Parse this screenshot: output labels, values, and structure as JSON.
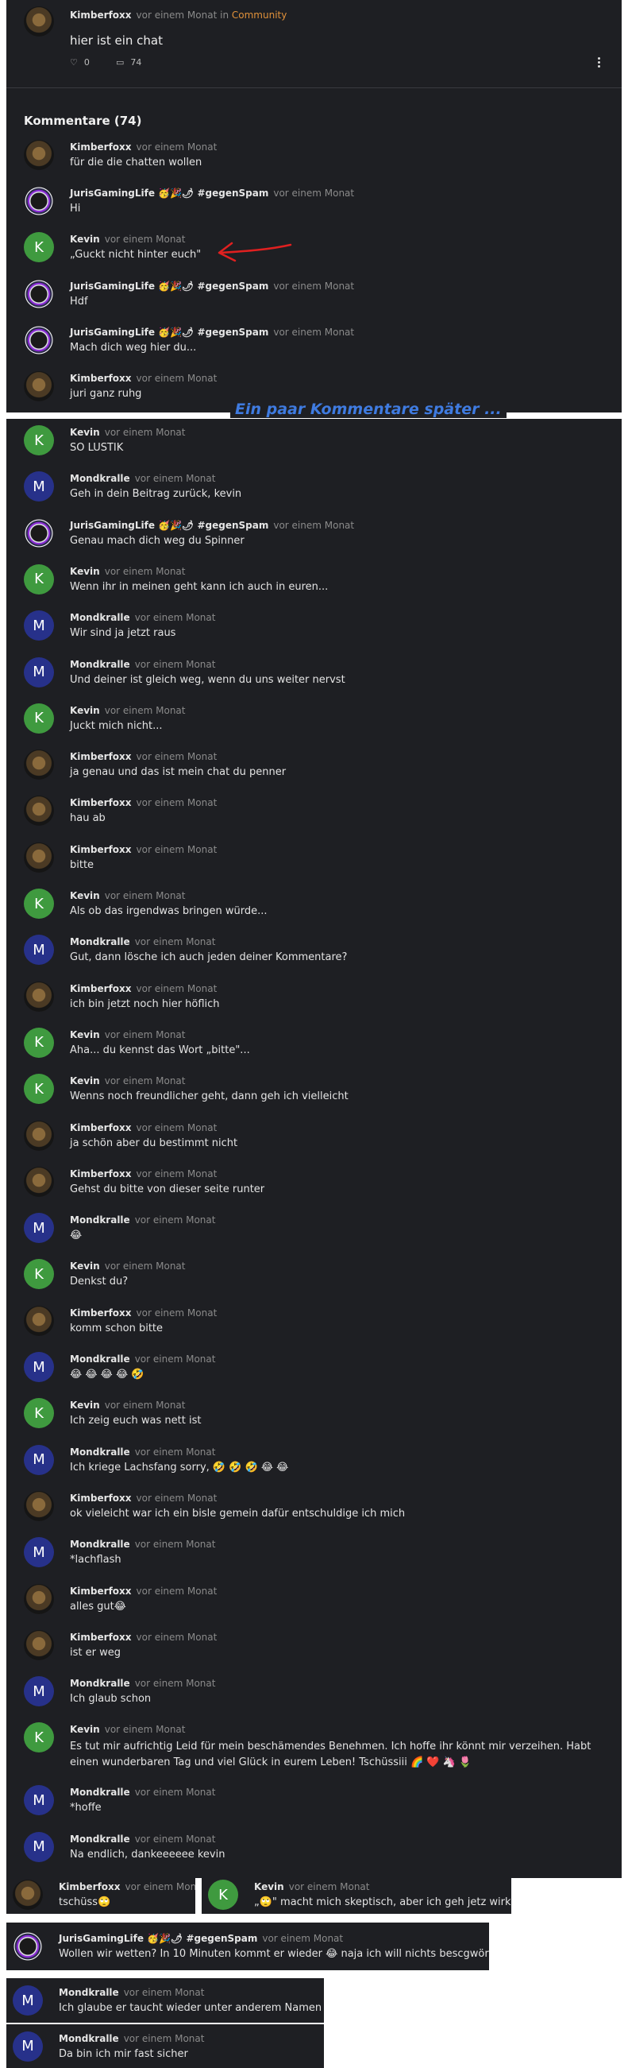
{
  "post": {
    "author": "Kimberfoxx",
    "time": "vor einem Monat",
    "in_label": "in",
    "community": "Community",
    "title": "hier ist ein chat",
    "likes": "0",
    "comments_count": "74"
  },
  "comments_header": "Kommentare (74)",
  "banner_text": "Ein paar Kommentare später ...",
  "top_comments": [
    {
      "av": "lion",
      "initial": "",
      "name": "Kimberfoxx",
      "time": "vor einem Monat",
      "text": "für die die chatten wollen"
    },
    {
      "av": "juris",
      "initial": "",
      "name": "JurisGamingLife 🥳🎉🌶 #gegenSpam",
      "time": "vor einem Monat",
      "text": "Hi"
    },
    {
      "av": "k",
      "initial": "K",
      "name": "Kevin",
      "time": "vor einem Monat",
      "text": "„Guckt nicht hinter euch\""
    },
    {
      "av": "juris",
      "initial": "",
      "name": "JurisGamingLife 🥳🎉🌶 #gegenSpam",
      "time": "vor einem Monat",
      "text": "Hdf"
    },
    {
      "av": "juris",
      "initial": "",
      "name": "JurisGamingLife 🥳🎉🌶 #gegenSpam",
      "time": "vor einem Monat",
      "text": "Mach dich weg hier du..."
    },
    {
      "av": "lion",
      "initial": "",
      "name": "Kimberfoxx",
      "time": "vor einem Monat",
      "text": "juri ganz ruhg"
    }
  ],
  "thread_comments": [
    {
      "av": "k",
      "initial": "K",
      "name": "Kevin",
      "time": "vor einem Monat",
      "text": "SO LUSTIK"
    },
    {
      "av": "m",
      "initial": "M",
      "name": "Mondkralle",
      "time": "vor einem Monat",
      "text": "Geh in dein Beitrag zurück, kevin"
    },
    {
      "av": "juris",
      "initial": "",
      "name": "JurisGamingLife 🥳🎉🌶 #gegenSpam",
      "time": "vor einem Monat",
      "text": "Genau mach dich weg du Spinner"
    },
    {
      "av": "k",
      "initial": "K",
      "name": "Kevin",
      "time": "vor einem Monat",
      "text": "Wenn ihr in meinen geht kann ich auch in euren..."
    },
    {
      "av": "m",
      "initial": "M",
      "name": "Mondkralle",
      "time": "vor einem Monat",
      "text": "Wir sind ja jetzt raus"
    },
    {
      "av": "m",
      "initial": "M",
      "name": "Mondkralle",
      "time": "vor einem Monat",
      "text": "Und deiner ist gleich weg, wenn du uns weiter nervst"
    },
    {
      "av": "k",
      "initial": "K",
      "name": "Kevin",
      "time": "vor einem Monat",
      "text": "Juckt mich nicht..."
    },
    {
      "av": "lion",
      "initial": "",
      "name": "Kimberfoxx",
      "time": "vor einem Monat",
      "text": "ja genau und das ist mein chat du penner"
    },
    {
      "av": "lion",
      "initial": "",
      "name": "Kimberfoxx",
      "time": "vor einem Monat",
      "text": "hau ab"
    },
    {
      "av": "lion",
      "initial": "",
      "name": "Kimberfoxx",
      "time": "vor einem Monat",
      "text": "bitte"
    },
    {
      "av": "k",
      "initial": "K",
      "name": "Kevin",
      "time": "vor einem Monat",
      "text": "Als ob das irgendwas bringen würde..."
    },
    {
      "av": "m",
      "initial": "M",
      "name": "Mondkralle",
      "time": "vor einem Monat",
      "text": "Gut, dann lösche ich auch jeden deiner Kommentare?"
    },
    {
      "av": "lion",
      "initial": "",
      "name": "Kimberfoxx",
      "time": "vor einem Monat",
      "text": "ich bin jetzt noch hier höflich"
    },
    {
      "av": "k",
      "initial": "K",
      "name": "Kevin",
      "time": "vor einem Monat",
      "text": "Aha... du kennst das Wort „bitte\"..."
    },
    {
      "av": "k",
      "initial": "K",
      "name": "Kevin",
      "time": "vor einem Monat",
      "text": "Wenns noch freundlicher geht, dann geh ich vielleicht"
    },
    {
      "av": "lion",
      "initial": "",
      "name": "Kimberfoxx",
      "time": "vor einem Monat",
      "text": "ja schön aber du bestimmt nicht"
    },
    {
      "av": "lion",
      "initial": "",
      "name": "Kimberfoxx",
      "time": "vor einem Monat",
      "text": "Gehst du bitte von dieser seite runter"
    },
    {
      "av": "m",
      "initial": "M",
      "name": "Mondkralle",
      "time": "vor einem Monat",
      "text": "😂"
    },
    {
      "av": "k",
      "initial": "K",
      "name": "Kevin",
      "time": "vor einem Monat",
      "text": "Denkst du?"
    },
    {
      "av": "lion",
      "initial": "",
      "name": "Kimberfoxx",
      "time": "vor einem Monat",
      "text": "komm schon bitte"
    },
    {
      "av": "m",
      "initial": "M",
      "name": "Mondkralle",
      "time": "vor einem Monat",
      "text": "😂 😂 😂 😂 🤣"
    },
    {
      "av": "k",
      "initial": "K",
      "name": "Kevin",
      "time": "vor einem Monat",
      "text": "Ich zeig euch was nett ist"
    },
    {
      "av": "m",
      "initial": "M",
      "name": "Mondkralle",
      "time": "vor einem Monat",
      "text": "Ich kriege Lachsfang sorry, 🤣 🤣 🤣 😂 😂"
    },
    {
      "av": "lion",
      "initial": "",
      "name": "Kimberfoxx",
      "time": "vor einem Monat",
      "text": "ok vieleicht war ich ein bisle gemein dafür entschuldige ich mich"
    },
    {
      "av": "m",
      "initial": "M",
      "name": "Mondkralle",
      "time": "vor einem Monat",
      "text": "*lachflash"
    },
    {
      "av": "lion",
      "initial": "",
      "name": "Kimberfoxx",
      "time": "vor einem Monat",
      "text": "alles gut😂"
    },
    {
      "av": "lion",
      "initial": "",
      "name": "Kimberfoxx",
      "time": "vor einem Monat",
      "text": "ist er weg"
    },
    {
      "av": "m",
      "initial": "M",
      "name": "Mondkralle",
      "time": "vor einem Monat",
      "text": "Ich glaub schon"
    },
    {
      "av": "k",
      "initial": "K",
      "name": "Kevin",
      "time": "vor einem Monat",
      "text": "Es tut mir aufrichtig Leid für mein beschämendes Benehmen. Ich hoffe ihr könnt mir verzeihen. Habt einen wunderbaren Tag und viel Glück in eurem Leben! Tschüssiii 🌈 ❤️ 🦄 🌷"
    },
    {
      "av": "m",
      "initial": "M",
      "name": "Mondkralle",
      "time": "vor einem Monat",
      "text": "*hoffe"
    },
    {
      "av": "m",
      "initial": "M",
      "name": "Mondkralle",
      "time": "vor einem Monat",
      "text": "Na endlich, dankeeeeee kevin"
    }
  ],
  "snippets": [
    {
      "av": "lion",
      "initial": "",
      "name": "Kimberfoxx",
      "time": "vor einem Monat",
      "text": "tschüss🙄"
    },
    {
      "av": "k",
      "initial": "K",
      "name": "Kevin",
      "time": "vor einem Monat",
      "text": "„🙄\" macht mich skeptisch, aber ich geh jetz wirklich"
    },
    {
      "av": "juris",
      "initial": "",
      "name": "JurisGamingLife 🥳🎉🌶 #gegenSpam",
      "time": "vor einem Monat",
      "text": "Wollen wir wetten? In 10 Minuten kommt er wieder 😂 naja ich will nichts bescgwören.."
    },
    {
      "av": "m",
      "initial": "M",
      "name": "Mondkralle",
      "time": "vor einem Monat",
      "text": "Ich glaube er taucht wieder unter anderem Namen auf"
    },
    {
      "av": "m",
      "initial": "M",
      "name": "Mondkralle",
      "time": "vor einem Monat",
      "text": "Da bin ich mir fast sicher"
    }
  ]
}
